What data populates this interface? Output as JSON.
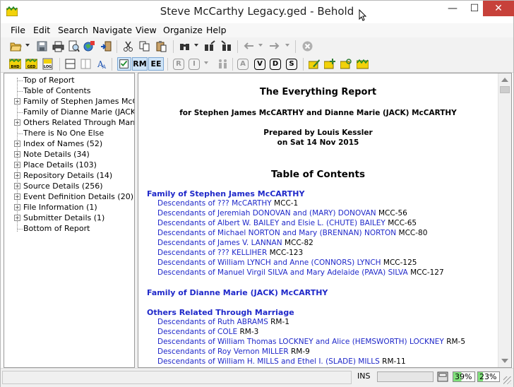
{
  "window": {
    "title": "Steve McCarthy Legacy.ged - Behold",
    "min_glyph": "—",
    "max_glyph": "☐",
    "close_glyph": "✕"
  },
  "menu": {
    "file": "File",
    "edit": "Edit",
    "search": "Search",
    "navigate": "Navigate",
    "view": "View",
    "organize": "Organize",
    "help": "Help"
  },
  "toolbar2": {
    "rm": "RM",
    "ee": "EE",
    "r_box": "R",
    "i_box": "I",
    "a_box": "A",
    "v_box": "V",
    "d_box": "D",
    "s_box": "S",
    "bhd_tag": "BHD",
    "ged_tag": "GED",
    "log_tag": "LOG"
  },
  "tree": {
    "items": [
      {
        "label": "Top of Report",
        "expandable": false
      },
      {
        "label": "Table of Contents",
        "expandable": false
      },
      {
        "label": "Family of Stephen James McCAR",
        "expandable": true
      },
      {
        "label": "Family of Dianne Marie (JACK) M",
        "expandable": false
      },
      {
        "label": "Others Related Through Marriage",
        "expandable": true
      },
      {
        "label": "There is No One Else",
        "expandable": false
      },
      {
        "label": "Index of Names (52)",
        "expandable": true
      },
      {
        "label": "Note Details (34)",
        "expandable": true
      },
      {
        "label": "Place Details (103)",
        "expandable": true
      },
      {
        "label": "Repository Details (14)",
        "expandable": true
      },
      {
        "label": "Source Details (256)",
        "expandable": true
      },
      {
        "label": "Event Definition Details (20)",
        "expandable": true
      },
      {
        "label": "File Information (1)",
        "expandable": true
      },
      {
        "label": "Submitter Details (1)",
        "expandable": true
      },
      {
        "label": "Bottom of Report",
        "expandable": false
      }
    ]
  },
  "report": {
    "title": "The Everything Report",
    "subtitle": "for Stephen James McCARTHY and Dianne Marie (JACK) McCARTHY",
    "prepared_by": "Prepared by Louis Kessler",
    "prepared_on": "on Sat 14 Nov 2015",
    "toc_heading": "Table of Contents",
    "sections": [
      {
        "heading": "Family of Stephen James McCARTHY",
        "entries": [
          {
            "link": "Descendants of ??? McCARTHY",
            "code": "MCC-1"
          },
          {
            "link": "Descendants of Jeremiah DONOVAN and (MARY) DONOVAN",
            "code": "MCC-56"
          },
          {
            "link": "Descendants of Albert W. BAILEY and Elsie L. (CHUTE) BAILEY",
            "code": "MCC-65"
          },
          {
            "link": "Descendants of Michael NORTON and Mary (BRENNAN) NORTON",
            "code": "MCC-80"
          },
          {
            "link": "Descendants of James V. LANNAN",
            "code": "MCC-82"
          },
          {
            "link": "Descendants of ??? KELLIHER",
            "code": "MCC-123"
          },
          {
            "link": "Descendants of William LYNCH and Anne (CONNORS) LYNCH",
            "code": "MCC-125"
          },
          {
            "link": "Descendants of Manuel Virgil SILVA and Mary Adelaide (PAVA) SILVA",
            "code": "MCC-127"
          }
        ]
      },
      {
        "heading": "Family of Dianne Marie (JACK) McCARTHY",
        "entries": []
      },
      {
        "heading": "Others Related Through Marriage",
        "entries": [
          {
            "link": "Descendants of Ruth ABRAMS",
            "code": "RM-1"
          },
          {
            "link": "Descendants of COLE",
            "code": "RM-3"
          },
          {
            "link": "Descendants of William Thomas LOCKNEY and Alice (HEMSWORTH) LOCKNEY",
            "code": "RM-5"
          },
          {
            "link": "Descendants of Roy Vernon MILLER",
            "code": "RM-9"
          },
          {
            "link": "Descendants of William H. MILLS and Ethel I. (SLADE) MILLS",
            "code": "RM-11"
          }
        ]
      }
    ]
  },
  "status": {
    "ins": "INS",
    "pct1": "39%",
    "pct1_value": 0.39,
    "pct2": "23%",
    "pct2_value": 0.23
  },
  "colors": {
    "link": "#1f28c9",
    "close_button": "#c7413a",
    "progress_fill": "#7fe07a"
  }
}
